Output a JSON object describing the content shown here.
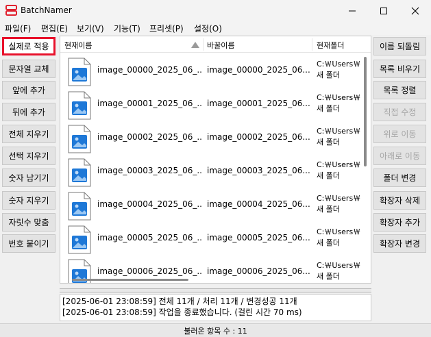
{
  "window": {
    "title": "BatchNamer",
    "app_icon": "app-logo-icon",
    "minimize_icon": "minimize-icon",
    "maximize_icon": "maximize-icon",
    "close_icon": "close-icon"
  },
  "menu": [
    {
      "label": "파일(F)"
    },
    {
      "label": "편집(E)"
    },
    {
      "label": "보기(V)"
    },
    {
      "label": "기능(T)"
    },
    {
      "label": "프리셋(P)"
    },
    {
      "label": "설정(O)"
    }
  ],
  "left_buttons": [
    {
      "label": "실제로 적용"
    },
    {
      "label": "문자열 교체"
    },
    {
      "label": "앞에 추가"
    },
    {
      "label": "뒤에 추가"
    },
    {
      "label": "전체 지우기"
    },
    {
      "label": "선택 지우기"
    },
    {
      "label": "숫자 남기기"
    },
    {
      "label": "숫자 지우기"
    },
    {
      "label": "자릿수 맞춤"
    },
    {
      "label": "번호 붙이기"
    }
  ],
  "right_buttons": [
    {
      "label": "이름 되돌림",
      "enabled": true
    },
    {
      "label": "목록 비우기",
      "enabled": true
    },
    {
      "label": "목록 정렬",
      "enabled": true
    },
    {
      "label": "직접 수정",
      "enabled": false
    },
    {
      "label": "위로 이동",
      "enabled": false
    },
    {
      "label": "아래로 이동",
      "enabled": false
    },
    {
      "label": "폴더 변경",
      "enabled": true
    },
    {
      "label": "확장자 삭제",
      "enabled": true
    },
    {
      "label": "확장자 추가",
      "enabled": true
    },
    {
      "label": "확장자 변경",
      "enabled": true
    }
  ],
  "list": {
    "columns": [
      "현재이름",
      "바꿀이름",
      "현재폴더"
    ],
    "sort_icon": "sort-ascending-icon",
    "rows": [
      {
        "current": "image_00000_2025_06_...",
        "new": "image_00000_2025_06...",
        "folder_line1": "C:￦Users￦",
        "folder_line2": "새 폴더"
      },
      {
        "current": "image_00001_2025_06_...",
        "new": "image_00001_2025_06...",
        "folder_line1": "C:￦Users￦",
        "folder_line2": "새 폴더"
      },
      {
        "current": "image_00002_2025_06_...",
        "new": "image_00002_2025_06...",
        "folder_line1": "C:￦Users￦",
        "folder_line2": "새 폴더"
      },
      {
        "current": "image_00003_2025_06_...",
        "new": "image_00003_2025_06...",
        "folder_line1": "C:￦Users￦",
        "folder_line2": "새 폴더"
      },
      {
        "current": "image_00004_2025_06_...",
        "new": "image_00004_2025_06...",
        "folder_line1": "C:￦Users￦",
        "folder_line2": "새 폴더"
      },
      {
        "current": "image_00005_2025_06_...",
        "new": "image_00005_2025_06...",
        "folder_line1": "C:￦Users￦",
        "folder_line2": "새 폴더"
      },
      {
        "current": "image_00006_2025_06_...",
        "new": "image_00006_2025_06...",
        "folder_line1": "C:￦Users￦",
        "folder_line2": "새 폴더"
      }
    ]
  },
  "log": [
    "[2025-06-01 23:08:59] 전체 11개 /  처리 11개 / 변경성공 11개",
    "[2025-06-01 23:08:59] 작업을 종료했습니다. (걸린 시간 70 ms)"
  ],
  "status": "불러온 항목 수 : 11"
}
